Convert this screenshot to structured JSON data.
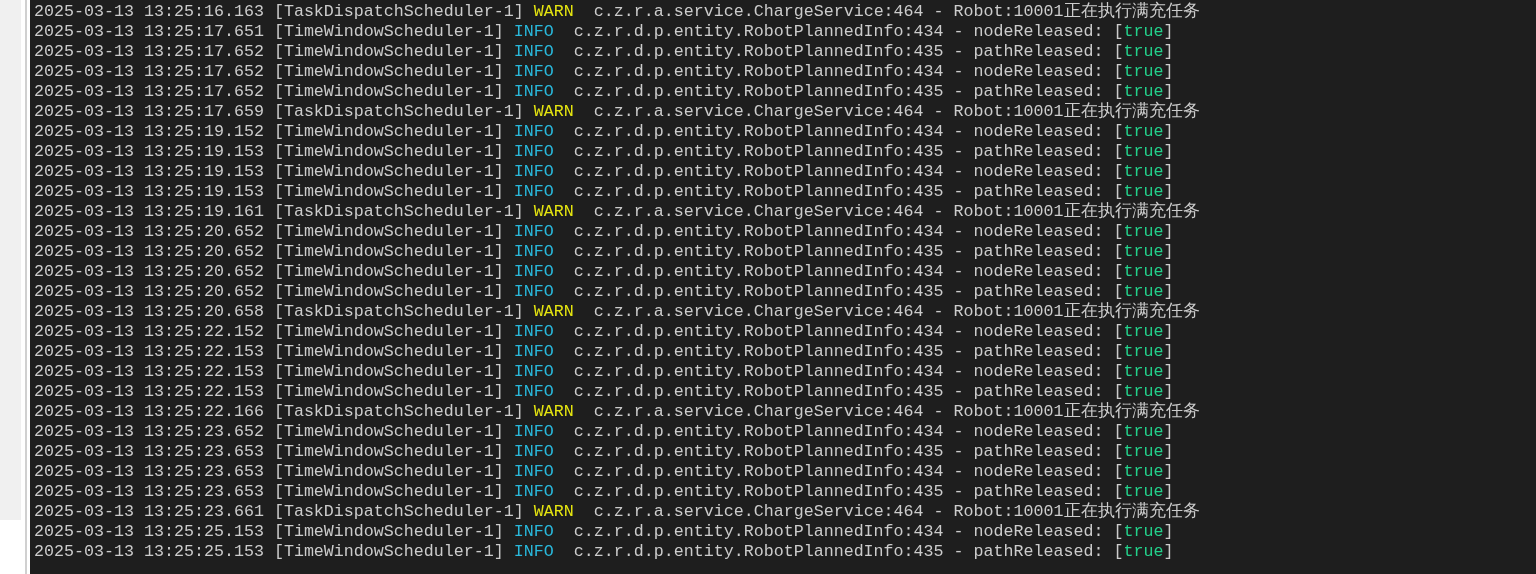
{
  "log_lines": [
    {
      "segments": [
        {
          "kind": "plain",
          "text": "2025-03-13 13:25:16.163 [TaskDispatchScheduler-1] "
        },
        {
          "kind": "warn",
          "text": "WARN"
        },
        {
          "kind": "plain",
          "text": "  c.z.r.a.service.ChargeService:464 - Robot:10001正在执行满充任务"
        }
      ]
    },
    {
      "segments": [
        {
          "kind": "plain",
          "text": "2025-03-13 13:25:17.651 [TimeWindowScheduler-1] "
        },
        {
          "kind": "info",
          "text": "INFO"
        },
        {
          "kind": "plain",
          "text": "  c.z.r.d.p.entity.RobotPlannedInfo:434 - nodeReleased: ["
        },
        {
          "kind": "bool",
          "text": "true"
        },
        {
          "kind": "plain",
          "text": "]"
        }
      ]
    },
    {
      "segments": [
        {
          "kind": "plain",
          "text": "2025-03-13 13:25:17.652 [TimeWindowScheduler-1] "
        },
        {
          "kind": "info",
          "text": "INFO"
        },
        {
          "kind": "plain",
          "text": "  c.z.r.d.p.entity.RobotPlannedInfo:435 - pathReleased: ["
        },
        {
          "kind": "bool",
          "text": "true"
        },
        {
          "kind": "plain",
          "text": "]"
        }
      ]
    },
    {
      "segments": [
        {
          "kind": "plain",
          "text": "2025-03-13 13:25:17.652 [TimeWindowScheduler-1] "
        },
        {
          "kind": "info",
          "text": "INFO"
        },
        {
          "kind": "plain",
          "text": "  c.z.r.d.p.entity.RobotPlannedInfo:434 - nodeReleased: ["
        },
        {
          "kind": "bool",
          "text": "true"
        },
        {
          "kind": "plain",
          "text": "]"
        }
      ]
    },
    {
      "segments": [
        {
          "kind": "plain",
          "text": "2025-03-13 13:25:17.652 [TimeWindowScheduler-1] "
        },
        {
          "kind": "info",
          "text": "INFO"
        },
        {
          "kind": "plain",
          "text": "  c.z.r.d.p.entity.RobotPlannedInfo:435 - pathReleased: ["
        },
        {
          "kind": "bool",
          "text": "true"
        },
        {
          "kind": "plain",
          "text": "]"
        }
      ]
    },
    {
      "segments": [
        {
          "kind": "plain",
          "text": "2025-03-13 13:25:17.659 [TaskDispatchScheduler-1] "
        },
        {
          "kind": "warn",
          "text": "WARN"
        },
        {
          "kind": "plain",
          "text": "  c.z.r.a.service.ChargeService:464 - Robot:10001正在执行满充任务"
        }
      ]
    },
    {
      "segments": [
        {
          "kind": "plain",
          "text": "2025-03-13 13:25:19.152 [TimeWindowScheduler-1] "
        },
        {
          "kind": "info",
          "text": "INFO"
        },
        {
          "kind": "plain",
          "text": "  c.z.r.d.p.entity.RobotPlannedInfo:434 - nodeReleased: ["
        },
        {
          "kind": "bool",
          "text": "true"
        },
        {
          "kind": "plain",
          "text": "]"
        }
      ]
    },
    {
      "segments": [
        {
          "kind": "plain",
          "text": "2025-03-13 13:25:19.153 [TimeWindowScheduler-1] "
        },
        {
          "kind": "info",
          "text": "INFO"
        },
        {
          "kind": "plain",
          "text": "  c.z.r.d.p.entity.RobotPlannedInfo:435 - pathReleased: ["
        },
        {
          "kind": "bool",
          "text": "true"
        },
        {
          "kind": "plain",
          "text": "]"
        }
      ]
    },
    {
      "segments": [
        {
          "kind": "plain",
          "text": "2025-03-13 13:25:19.153 [TimeWindowScheduler-1] "
        },
        {
          "kind": "info",
          "text": "INFO"
        },
        {
          "kind": "plain",
          "text": "  c.z.r.d.p.entity.RobotPlannedInfo:434 - nodeReleased: ["
        },
        {
          "kind": "bool",
          "text": "true"
        },
        {
          "kind": "plain",
          "text": "]"
        }
      ]
    },
    {
      "segments": [
        {
          "kind": "plain",
          "text": "2025-03-13 13:25:19.153 [TimeWindowScheduler-1] "
        },
        {
          "kind": "info",
          "text": "INFO"
        },
        {
          "kind": "plain",
          "text": "  c.z.r.d.p.entity.RobotPlannedInfo:435 - pathReleased: ["
        },
        {
          "kind": "bool",
          "text": "true"
        },
        {
          "kind": "plain",
          "text": "]"
        }
      ]
    },
    {
      "segments": [
        {
          "kind": "plain",
          "text": "2025-03-13 13:25:19.161 [TaskDispatchScheduler-1] "
        },
        {
          "kind": "warn",
          "text": "WARN"
        },
        {
          "kind": "plain",
          "text": "  c.z.r.a.service.ChargeService:464 - Robot:10001正在执行满充任务"
        }
      ]
    },
    {
      "segments": [
        {
          "kind": "plain",
          "text": "2025-03-13 13:25:20.652 [TimeWindowScheduler-1] "
        },
        {
          "kind": "info",
          "text": "INFO"
        },
        {
          "kind": "plain",
          "text": "  c.z.r.d.p.entity.RobotPlannedInfo:434 - nodeReleased: ["
        },
        {
          "kind": "bool",
          "text": "true"
        },
        {
          "kind": "plain",
          "text": "]"
        }
      ]
    },
    {
      "segments": [
        {
          "kind": "plain",
          "text": "2025-03-13 13:25:20.652 [TimeWindowScheduler-1] "
        },
        {
          "kind": "info",
          "text": "INFO"
        },
        {
          "kind": "plain",
          "text": "  c.z.r.d.p.entity.RobotPlannedInfo:435 - pathReleased: ["
        },
        {
          "kind": "bool",
          "text": "true"
        },
        {
          "kind": "plain",
          "text": "]"
        }
      ]
    },
    {
      "segments": [
        {
          "kind": "plain",
          "text": "2025-03-13 13:25:20.652 [TimeWindowScheduler-1] "
        },
        {
          "kind": "info",
          "text": "INFO"
        },
        {
          "kind": "plain",
          "text": "  c.z.r.d.p.entity.RobotPlannedInfo:434 - nodeReleased: ["
        },
        {
          "kind": "bool",
          "text": "true"
        },
        {
          "kind": "plain",
          "text": "]"
        }
      ]
    },
    {
      "segments": [
        {
          "kind": "plain",
          "text": "2025-03-13 13:25:20.652 [TimeWindowScheduler-1] "
        },
        {
          "kind": "info",
          "text": "INFO"
        },
        {
          "kind": "plain",
          "text": "  c.z.r.d.p.entity.RobotPlannedInfo:435 - pathReleased: ["
        },
        {
          "kind": "bool",
          "text": "true"
        },
        {
          "kind": "plain",
          "text": "]"
        }
      ]
    },
    {
      "segments": [
        {
          "kind": "plain",
          "text": "2025-03-13 13:25:20.658 [TaskDispatchScheduler-1] "
        },
        {
          "kind": "warn",
          "text": "WARN"
        },
        {
          "kind": "plain",
          "text": "  c.z.r.a.service.ChargeService:464 - Robot:10001正在执行满充任务"
        }
      ]
    },
    {
      "segments": [
        {
          "kind": "plain",
          "text": "2025-03-13 13:25:22.152 [TimeWindowScheduler-1] "
        },
        {
          "kind": "info",
          "text": "INFO"
        },
        {
          "kind": "plain",
          "text": "  c.z.r.d.p.entity.RobotPlannedInfo:434 - nodeReleased: ["
        },
        {
          "kind": "bool",
          "text": "true"
        },
        {
          "kind": "plain",
          "text": "]"
        }
      ]
    },
    {
      "segments": [
        {
          "kind": "plain",
          "text": "2025-03-13 13:25:22.153 [TimeWindowScheduler-1] "
        },
        {
          "kind": "info",
          "text": "INFO"
        },
        {
          "kind": "plain",
          "text": "  c.z.r.d.p.entity.RobotPlannedInfo:435 - pathReleased: ["
        },
        {
          "kind": "bool",
          "text": "true"
        },
        {
          "kind": "plain",
          "text": "]"
        }
      ]
    },
    {
      "segments": [
        {
          "kind": "plain",
          "text": "2025-03-13 13:25:22.153 [TimeWindowScheduler-1] "
        },
        {
          "kind": "info",
          "text": "INFO"
        },
        {
          "kind": "plain",
          "text": "  c.z.r.d.p.entity.RobotPlannedInfo:434 - nodeReleased: ["
        },
        {
          "kind": "bool",
          "text": "true"
        },
        {
          "kind": "plain",
          "text": "]"
        }
      ]
    },
    {
      "segments": [
        {
          "kind": "plain",
          "text": "2025-03-13 13:25:22.153 [TimeWindowScheduler-1] "
        },
        {
          "kind": "info",
          "text": "INFO"
        },
        {
          "kind": "plain",
          "text": "  c.z.r.d.p.entity.RobotPlannedInfo:435 - pathReleased: ["
        },
        {
          "kind": "bool",
          "text": "true"
        },
        {
          "kind": "plain",
          "text": "]"
        }
      ]
    },
    {
      "segments": [
        {
          "kind": "plain",
          "text": "2025-03-13 13:25:22.166 [TaskDispatchScheduler-1] "
        },
        {
          "kind": "warn",
          "text": "WARN"
        },
        {
          "kind": "plain",
          "text": "  c.z.r.a.service.ChargeService:464 - Robot:10001正在执行满充任务"
        }
      ]
    },
    {
      "segments": [
        {
          "kind": "plain",
          "text": "2025-03-13 13:25:23.652 [TimeWindowScheduler-1] "
        },
        {
          "kind": "info",
          "text": "INFO"
        },
        {
          "kind": "plain",
          "text": "  c.z.r.d.p.entity.RobotPlannedInfo:434 - nodeReleased: ["
        },
        {
          "kind": "bool",
          "text": "true"
        },
        {
          "kind": "plain",
          "text": "]"
        }
      ]
    },
    {
      "segments": [
        {
          "kind": "plain",
          "text": "2025-03-13 13:25:23.653 [TimeWindowScheduler-1] "
        },
        {
          "kind": "info",
          "text": "INFO"
        },
        {
          "kind": "plain",
          "text": "  c.z.r.d.p.entity.RobotPlannedInfo:435 - pathReleased: ["
        },
        {
          "kind": "bool",
          "text": "true"
        },
        {
          "kind": "plain",
          "text": "]"
        }
      ]
    },
    {
      "segments": [
        {
          "kind": "plain",
          "text": "2025-03-13 13:25:23.653 [TimeWindowScheduler-1] "
        },
        {
          "kind": "info",
          "text": "INFO"
        },
        {
          "kind": "plain",
          "text": "  c.z.r.d.p.entity.RobotPlannedInfo:434 - nodeReleased: ["
        },
        {
          "kind": "bool",
          "text": "true"
        },
        {
          "kind": "plain",
          "text": "]"
        }
      ]
    },
    {
      "segments": [
        {
          "kind": "plain",
          "text": "2025-03-13 13:25:23.653 [TimeWindowScheduler-1] "
        },
        {
          "kind": "info",
          "text": "INFO"
        },
        {
          "kind": "plain",
          "text": "  c.z.r.d.p.entity.RobotPlannedInfo:435 - pathReleased: ["
        },
        {
          "kind": "bool",
          "text": "true"
        },
        {
          "kind": "plain",
          "text": "]"
        }
      ]
    },
    {
      "segments": [
        {
          "kind": "plain",
          "text": "2025-03-13 13:25:23.661 [TaskDispatchScheduler-1] "
        },
        {
          "kind": "warn",
          "text": "WARN"
        },
        {
          "kind": "plain",
          "text": "  c.z.r.a.service.ChargeService:464 - Robot:10001正在执行满充任务"
        }
      ]
    },
    {
      "segments": [
        {
          "kind": "plain",
          "text": "2025-03-13 13:25:25.153 [TimeWindowScheduler-1] "
        },
        {
          "kind": "info",
          "text": "INFO"
        },
        {
          "kind": "plain",
          "text": "  c.z.r.d.p.entity.RobotPlannedInfo:434 - nodeReleased: ["
        },
        {
          "kind": "bool",
          "text": "true"
        },
        {
          "kind": "plain",
          "text": "]"
        }
      ]
    },
    {
      "segments": [
        {
          "kind": "plain",
          "text": "2025-03-13 13:25:25.153 [TimeWindowScheduler-1] "
        },
        {
          "kind": "info",
          "text": "INFO"
        },
        {
          "kind": "plain",
          "text": "  c.z.r.d.p.entity.RobotPlannedInfo:435 - pathReleased: ["
        },
        {
          "kind": "bool",
          "text": "true"
        },
        {
          "kind": "plain",
          "text": "]"
        }
      ]
    }
  ]
}
